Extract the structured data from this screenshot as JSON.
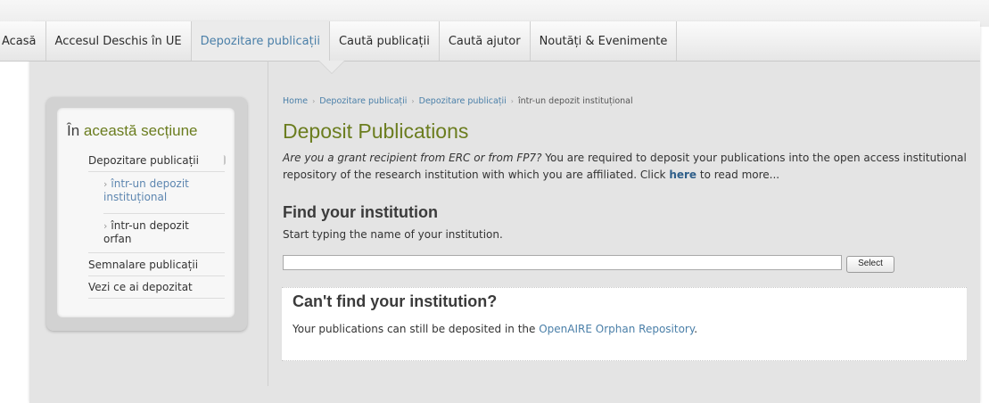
{
  "nav": {
    "items": [
      {
        "label": "Acasă"
      },
      {
        "label": "Accesul Deschis în UE"
      },
      {
        "label": "Depozitare publicații"
      },
      {
        "label": "Caută publicații"
      },
      {
        "label": "Caută ajutor"
      },
      {
        "label": "Noutăți & Evenimente"
      }
    ],
    "active_index": 2
  },
  "sidebar": {
    "title_prefix": "În",
    "title_rest": "această secțiune",
    "items": [
      {
        "label": "Depozitare publicații"
      },
      {
        "label": "Semnalare publicații"
      },
      {
        "label": "Vezi ce ai depozitat"
      }
    ],
    "subitems": [
      {
        "label": "într-un depozit instituțional"
      },
      {
        "label": "într-un depozit orfan"
      }
    ]
  },
  "breadcrumb": {
    "items": [
      "Home",
      "Depozitare publicații",
      "Depozitare publicații"
    ],
    "current": "într-un depozit instituțional"
  },
  "main": {
    "title": "Deposit Publications",
    "intro_italic": "Are you a grant recipient from ERC or from FP7?",
    "intro_text": " You are required to deposit your publications into the open access institutional repository of the research institution with which you are affiliated. Click ",
    "intro_link": "here",
    "intro_tail": " to read more...",
    "find_title": "Find your institution",
    "find_help": "Start typing the name of your institution.",
    "input_value": "",
    "select_label": "Select",
    "notfound_title": "Can't find your institution?",
    "notfound_text": "Your publications can still be deposited in the ",
    "notfound_link": "OpenAIRE Orphan Repository",
    "notfound_tail": "."
  },
  "colors": {
    "accent_green": "#6b7d1f",
    "link_blue": "#4a7fa8"
  }
}
